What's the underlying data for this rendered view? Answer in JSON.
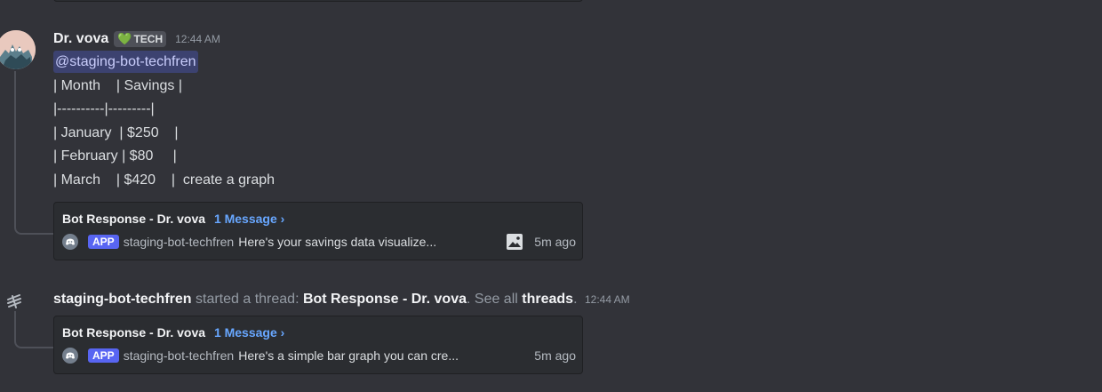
{
  "message": {
    "username": "Dr. vova",
    "tag_label": "TECH",
    "tag_emoji": "💚",
    "timestamp": "12:44 AM",
    "mention": "@staging-bot-techfren",
    "lines": [
      "| Month    | Savings |",
      "|----------|---------|",
      "| January  | $250    |",
      "| February | $80     |",
      "| March    | $420    |  create a graph"
    ]
  },
  "thread_cards": [
    {
      "title": "Bot Response - Dr. vova",
      "count": "1 Message ›",
      "badge": "APP",
      "bot_name": "staging-bot-techfren",
      "preview": "Here's your savings data visualize...",
      "has_image_icon": true,
      "time_ago": "5m ago"
    },
    {
      "title": "Bot Response - Dr. vova",
      "count": "1 Message ›",
      "badge": "APP",
      "bot_name": "staging-bot-techfren",
      "preview": "Here's a simple bar graph you can cre...",
      "has_image_icon": false,
      "time_ago": "5m ago"
    }
  ],
  "system_message": {
    "actor": "staging-bot-techfren",
    "action": " started a thread: ",
    "thread_name": "Bot Response - Dr. vova",
    "see_all": ". See all ",
    "threads_link": "threads",
    "period": ".",
    "timestamp": "12:44 AM"
  },
  "colors": {
    "background": "#323339",
    "card": "#2b2d31",
    "mention_bg": "#3c4270",
    "link_blue": "#68a7ff",
    "app_badge": "#5865f2",
    "tag_heart": "#23a559"
  }
}
